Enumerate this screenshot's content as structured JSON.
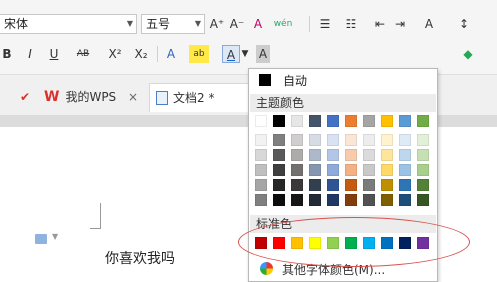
{
  "toolbar": {
    "font_name": "宋体",
    "font_size": "五号",
    "grow_font": "A⁺",
    "shrink_font": "A⁻",
    "clear_format": "A",
    "phonetic": "wén",
    "bullets": "☰",
    "numbering": "☷",
    "outdent": "⇤",
    "indent": "⇥",
    "text_effect": "A",
    "sort": "↕",
    "bold": "B",
    "italic": "I",
    "underline": "U",
    "strike": "AB",
    "superscript": "X²",
    "subscript": "X₂",
    "text_outline": "A",
    "highlight": "ab",
    "font_color": "A",
    "char_shade": "A",
    "align_left": "≡",
    "align_center": "≡",
    "align_right": "≡",
    "justify": "≡",
    "distribute": "⊟",
    "line_spacing": "☰",
    "fill": "◆"
  },
  "tabs": [
    {
      "label": "我的WPS",
      "close": "×"
    },
    {
      "label": "文档2 *"
    }
  ],
  "doc": {
    "text": "你喜欢我吗"
  },
  "color_menu": {
    "auto_label": "自动",
    "theme_title": "主题颜色",
    "standard_title": "标准色",
    "more_label": "其他字体颜色(M)...",
    "theme_top_row": [
      "#ffffff",
      "#000000",
      "#e7e6e6",
      "#44546a",
      "#4472c4",
      "#ed7d31",
      "#a5a5a5",
      "#ffc000",
      "#5b9bd5",
      "#70ad47"
    ],
    "theme_shades": [
      [
        "#f2f2f2",
        "#7f7f7f",
        "#d0cece",
        "#d6dce4",
        "#d9e2f3",
        "#fbe5d5",
        "#ededed",
        "#fff2cc",
        "#deebf6",
        "#e2efd9"
      ],
      [
        "#d8d8d8",
        "#595959",
        "#aeabab",
        "#adb9ca",
        "#b4c6e7",
        "#f7cbac",
        "#dbdbdb",
        "#fee599",
        "#bdd7ee",
        "#c5e0b3"
      ],
      [
        "#bfbfbf",
        "#3f3f3f",
        "#757070",
        "#8496b0",
        "#8eaadb",
        "#f4b183",
        "#c9c9c9",
        "#ffd965",
        "#9cc3e5",
        "#a8d08d"
      ],
      [
        "#a5a5a5",
        "#262626",
        "#3a3838",
        "#323f4f",
        "#2f5496",
        "#c55a11",
        "#7b7b7b",
        "#bf8f00",
        "#2e75b5",
        "#538135"
      ],
      [
        "#7f7f7f",
        "#0c0c0c",
        "#171616",
        "#222a35",
        "#1f3864",
        "#833c0b",
        "#525252",
        "#7f6000",
        "#1e4e79",
        "#375623"
      ]
    ],
    "standard_colors": [
      "#c00000",
      "#ff0000",
      "#ffc000",
      "#ffff00",
      "#92d050",
      "#00b050",
      "#00b0f0",
      "#0070c0",
      "#002060",
      "#7030a0"
    ]
  }
}
